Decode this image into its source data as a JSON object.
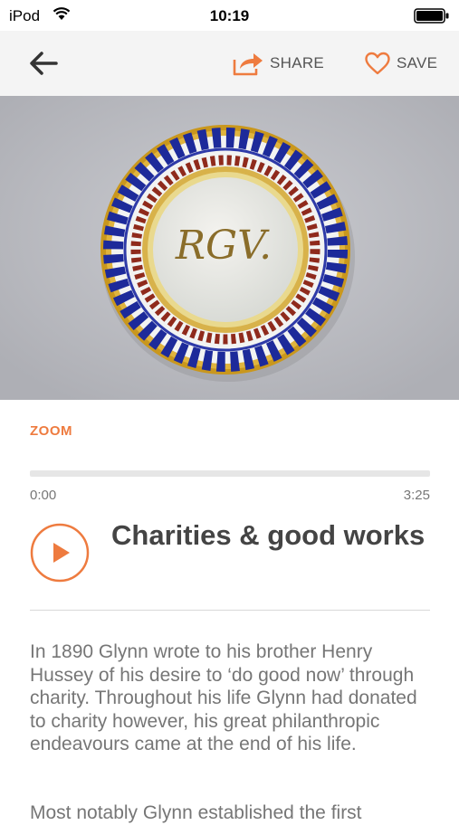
{
  "status_bar": {
    "carrier": "iPod",
    "time": "10:19"
  },
  "nav": {
    "share_label": "SHARE",
    "save_label": "SAVE"
  },
  "artwork": {
    "monogram": "RGV."
  },
  "zoom_label": "ZOOM",
  "audio": {
    "progress": 0,
    "current_time": "0:00",
    "duration": "3:25"
  },
  "track": {
    "title": "Charities & good works"
  },
  "paragraphs": [
    "In 1890 Glynn wrote to his brother Henry Hussey of his desire to ‘do good now’ through charity. Throughout his life Glynn had donated to charity however, his great philanthropic endeavours came at the end of his life.",
    "Most notably Glynn established the first"
  ],
  "colors": {
    "accent": "#ee7b3f",
    "text": "#767676",
    "title": "#444444",
    "navbar": "#f4f4f4"
  }
}
